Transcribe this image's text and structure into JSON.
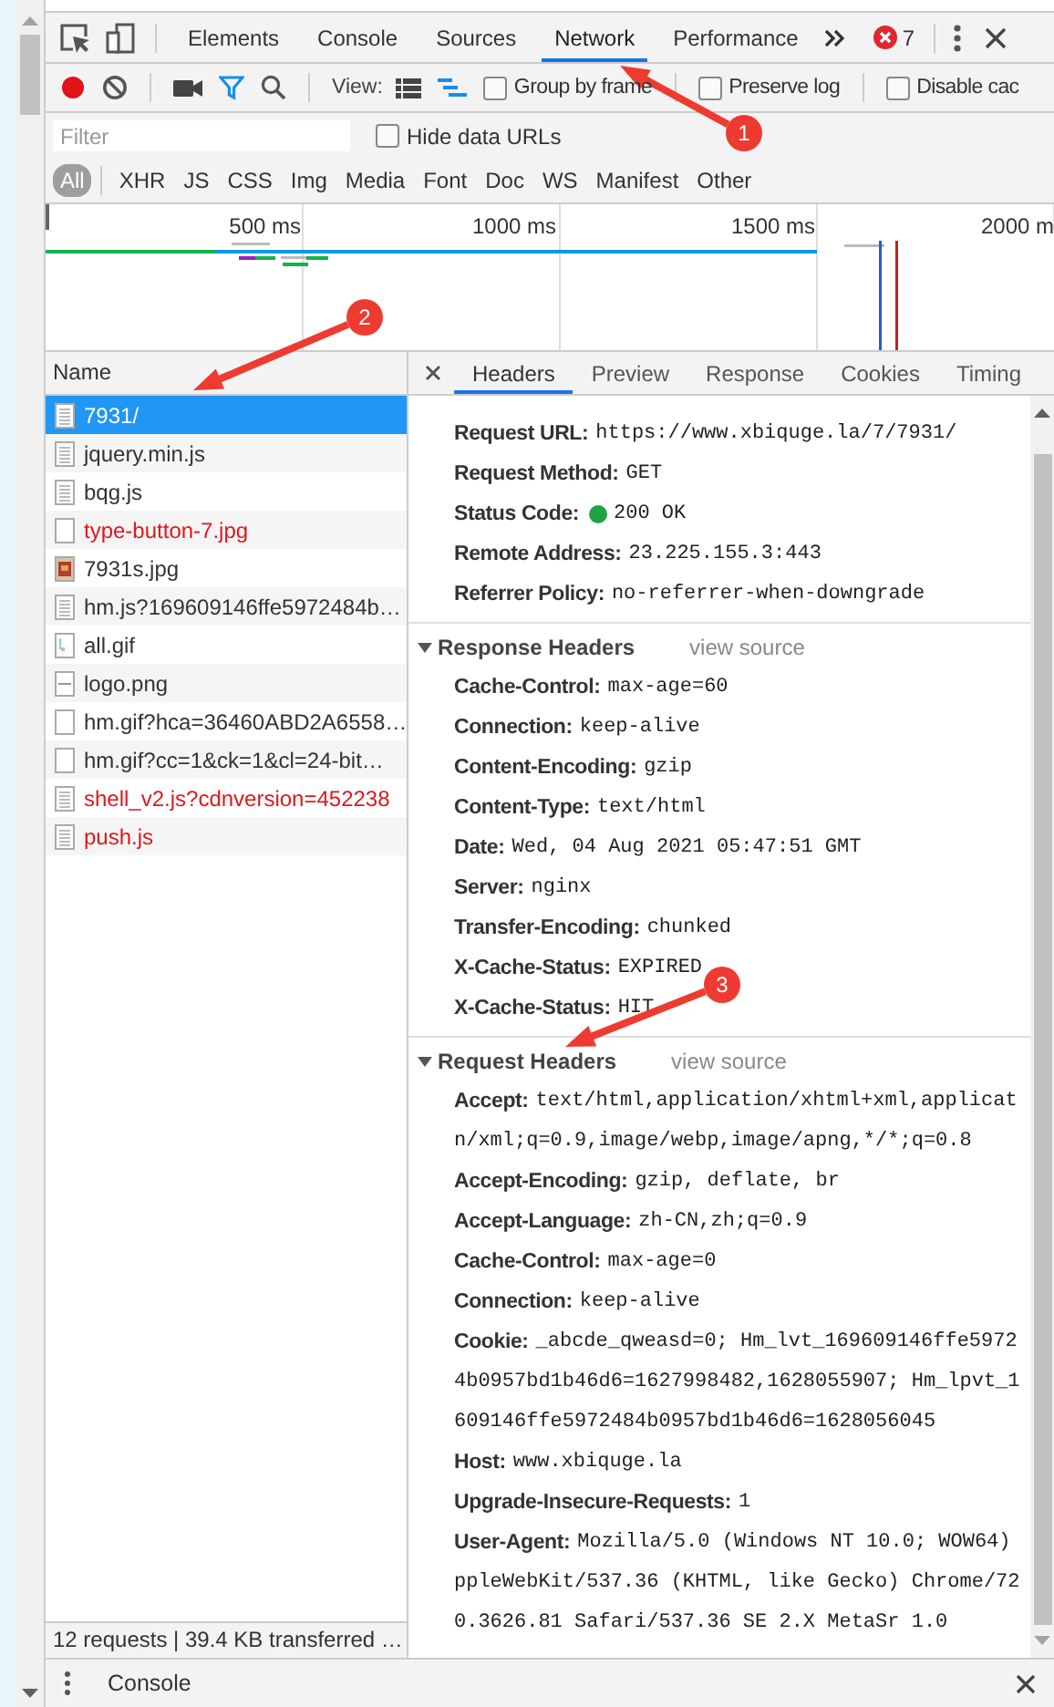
{
  "devtools_tabs": [
    {
      "label": "Elements",
      "selected": false
    },
    {
      "label": "Console",
      "selected": false
    },
    {
      "label": "Sources",
      "selected": false
    },
    {
      "label": "Network",
      "selected": true
    },
    {
      "label": "Performance",
      "selected": false
    }
  ],
  "error_count": "7",
  "toolbar": {
    "recording": true,
    "view_label": "View:",
    "checkboxes": [
      {
        "label": "Group by frame",
        "checked": false
      },
      {
        "label": "Preserve log",
        "checked": false
      },
      {
        "label": "Disable cac",
        "checked": false
      }
    ]
  },
  "filter": {
    "placeholder": "Filter",
    "hide_data_urls": {
      "label": "Hide data URLs",
      "checked": false
    }
  },
  "type_filters": [
    {
      "label": "All",
      "selected": true
    },
    {
      "label": "XHR",
      "selected": false
    },
    {
      "label": "JS",
      "selected": false
    },
    {
      "label": "CSS",
      "selected": false
    },
    {
      "label": "Img",
      "selected": false
    },
    {
      "label": "Media",
      "selected": false
    },
    {
      "label": "Font",
      "selected": false
    },
    {
      "label": "Doc",
      "selected": false
    },
    {
      "label": "WS",
      "selected": false
    },
    {
      "label": "Manifest",
      "selected": false
    },
    {
      "label": "Other",
      "selected": false
    }
  ],
  "overview": {
    "ticks": [
      "500 ms",
      "1000 ms",
      "1500 ms",
      "2000 m"
    ]
  },
  "requests": {
    "column": "Name",
    "rows": [
      {
        "name": "7931/",
        "kind": "document",
        "failed": false,
        "selected": true
      },
      {
        "name": "jquery.min.js",
        "kind": "document",
        "failed": false,
        "selected": false
      },
      {
        "name": "bqg.js",
        "kind": "document",
        "failed": false,
        "selected": false
      },
      {
        "name": "type-button-7.jpg",
        "kind": "blank",
        "failed": true,
        "selected": false
      },
      {
        "name": "7931s.jpg",
        "kind": "image",
        "failed": false,
        "selected": false
      },
      {
        "name": "hm.js?169609146ffe5972484b…",
        "kind": "document",
        "failed": false,
        "selected": false
      },
      {
        "name": "all.gif",
        "kind": "gif",
        "failed": false,
        "selected": false
      },
      {
        "name": "logo.png",
        "kind": "line",
        "failed": false,
        "selected": false
      },
      {
        "name": "hm.gif?hca=36460ABD2A6558…",
        "kind": "blank",
        "failed": false,
        "selected": false
      },
      {
        "name": "hm.gif?cc=1&ck=1&cl=24-bit…",
        "kind": "blank",
        "failed": false,
        "selected": false
      },
      {
        "name": "shell_v2.js?cdnversion=452238",
        "kind": "document",
        "failed": true,
        "selected": false
      },
      {
        "name": "push.js",
        "kind": "document",
        "failed": true,
        "selected": false
      }
    ]
  },
  "detail_tabs": [
    {
      "label": "Headers",
      "selected": true
    },
    {
      "label": "Preview",
      "selected": false
    },
    {
      "label": "Response",
      "selected": false
    },
    {
      "label": "Cookies",
      "selected": false
    },
    {
      "label": "Timing",
      "selected": false
    }
  ],
  "general": [
    {
      "name": "Request URL:",
      "value_lines": [
        "https://www.xbiquge.la/7/7931/"
      ]
    },
    {
      "name": "Request Method:",
      "value_lines": [
        "GET"
      ]
    },
    {
      "name": "Status Code:",
      "value_lines": [
        "200 OK"
      ],
      "kind": "status"
    },
    {
      "name": "Remote Address:",
      "value_lines": [
        "23.225.155.3:443"
      ]
    },
    {
      "name": "Referrer Policy:",
      "value_lines": [
        "no-referrer-when-downgrade"
      ]
    }
  ],
  "sections": [
    {
      "title": "Response Headers",
      "expanded": true,
      "link": "view source",
      "headers": [
        {
          "name": "Cache-Control:",
          "value_lines": [
            "max-age=60"
          ]
        },
        {
          "name": "Connection:",
          "value_lines": [
            "keep-alive"
          ]
        },
        {
          "name": "Content-Encoding:",
          "value_lines": [
            "gzip"
          ]
        },
        {
          "name": "Content-Type:",
          "value_lines": [
            "text/html"
          ]
        },
        {
          "name": "Date:",
          "value_lines": [
            "Wed, 04 Aug 2021 05:47:51 GMT"
          ]
        },
        {
          "name": "Server:",
          "value_lines": [
            "nginx"
          ]
        },
        {
          "name": "Transfer-Encoding:",
          "value_lines": [
            "chunked"
          ]
        },
        {
          "name": "X-Cache-Status:",
          "value_lines": [
            "EXPIRED"
          ]
        },
        {
          "name": "X-Cache-Status:",
          "value_lines": [
            "HIT"
          ]
        }
      ]
    },
    {
      "title": "Request Headers",
      "expanded": true,
      "link": "view source",
      "headers": [
        {
          "name": "Accept:",
          "value_lines": [
            "text/html,application/xhtml+xml,applicat",
            "n/xml;q=0.9,image/webp,image/apng,*/*;q=0.8"
          ]
        },
        {
          "name": "Accept-Encoding:",
          "value_lines": [
            "gzip, deflate, br"
          ]
        },
        {
          "name": "Accept-Language:",
          "value_lines": [
            "zh-CN,zh;q=0.9"
          ]
        },
        {
          "name": "Cache-Control:",
          "value_lines": [
            "max-age=0"
          ]
        },
        {
          "name": "Connection:",
          "value_lines": [
            "keep-alive"
          ]
        },
        {
          "name": "Cookie:",
          "value_lines": [
            "_abcde_qweasd=0; Hm_lvt_169609146ffe5972",
            "4b0957bd1b46d6=1627998482,1628055907; Hm_lpvt_1",
            "609146ffe5972484b0957bd1b46d6=1628056045"
          ]
        },
        {
          "name": "Host:",
          "value_lines": [
            "www.xbiquge.la"
          ]
        },
        {
          "name": "Upgrade-Insecure-Requests:",
          "value_lines": [
            "1"
          ]
        },
        {
          "name": "User-Agent:",
          "value_lines": [
            "Mozilla/5.0 (Windows NT 10.0; WOW64)",
            "ppleWebKit/537.36 (KHTML, like Gecko) Chrome/72",
            "0.3626.81 Safari/537.36 SE 2.X MetaSr 1.0"
          ]
        }
      ]
    }
  ],
  "status_bar": "12 requests | 39.4 KB transferred …",
  "drawer": {
    "tab": "Console"
  },
  "annotations": [
    "1",
    "2",
    "3"
  ]
}
